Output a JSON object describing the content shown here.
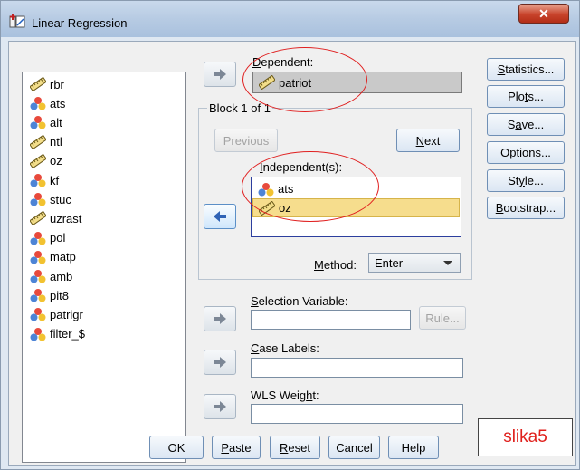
{
  "window": {
    "title": "Linear Regression",
    "close_glyph": "✕"
  },
  "variables": [
    {
      "name": "rbr",
      "icon": "ruler-icon"
    },
    {
      "name": "ats",
      "icon": "nominal-icon"
    },
    {
      "name": "alt",
      "icon": "nominal-icon"
    },
    {
      "name": "ntl",
      "icon": "ruler-icon"
    },
    {
      "name": "oz",
      "icon": "ruler-icon"
    },
    {
      "name": "kf",
      "icon": "nominal-icon"
    },
    {
      "name": "stuc",
      "icon": "nominal-icon"
    },
    {
      "name": "uzrast",
      "icon": "ruler-icon"
    },
    {
      "name": "pol",
      "icon": "nominal-icon"
    },
    {
      "name": "matp",
      "icon": "nominal-icon"
    },
    {
      "name": "amb",
      "icon": "nominal-icon"
    },
    {
      "name": "pit8",
      "icon": "nominal-icon"
    },
    {
      "name": "patrigr",
      "icon": "nominal-icon"
    },
    {
      "name": "filter_$",
      "icon": "nominal-icon"
    }
  ],
  "dependent": {
    "label_key": "D",
    "label_rest": "ependent:",
    "value": "patriot"
  },
  "block": {
    "title": "Block 1 of 1",
    "previous": "Previous",
    "next_key": "N",
    "next_rest": "ext"
  },
  "independent": {
    "label_key": "I",
    "label_rest": "ndependent(s):",
    "items": [
      "ats",
      "oz"
    ]
  },
  "method": {
    "label_key": "M",
    "label_rest": "ethod:",
    "value": "Enter"
  },
  "selection": {
    "label_key": "S",
    "label_rest": "election Variable:",
    "rule": "Rule..."
  },
  "case_labels": {
    "label_key": "C",
    "label_rest": "ase Labels:"
  },
  "wls": {
    "label_pre": "WLS Weig",
    "label_key": "h",
    "label_post": "t:"
  },
  "side_buttons": {
    "statistics": {
      "key": "S",
      "rest": "tatistics..."
    },
    "plots": {
      "pre": "Plo",
      "key": "t",
      "post": "s..."
    },
    "save": {
      "pre": "S",
      "key": "a",
      "post": "ve..."
    },
    "options": {
      "key": "O",
      "rest": "ptions..."
    },
    "style": {
      "pre": "St",
      "key": "y",
      "post": "le..."
    },
    "bootstrap": {
      "key": "B",
      "rest": "ootstrap..."
    }
  },
  "bottom_buttons": {
    "ok": "OK",
    "paste": {
      "key": "P",
      "rest": "aste"
    },
    "reset": {
      "key": "R",
      "rest": "eset"
    },
    "cancel": "Cancel",
    "help": "Help"
  },
  "annotation": "slika5",
  "colors": {
    "accent": "#2f63b6",
    "annotation_red": "#e0201c",
    "selected_row": "#f6dd8d"
  }
}
